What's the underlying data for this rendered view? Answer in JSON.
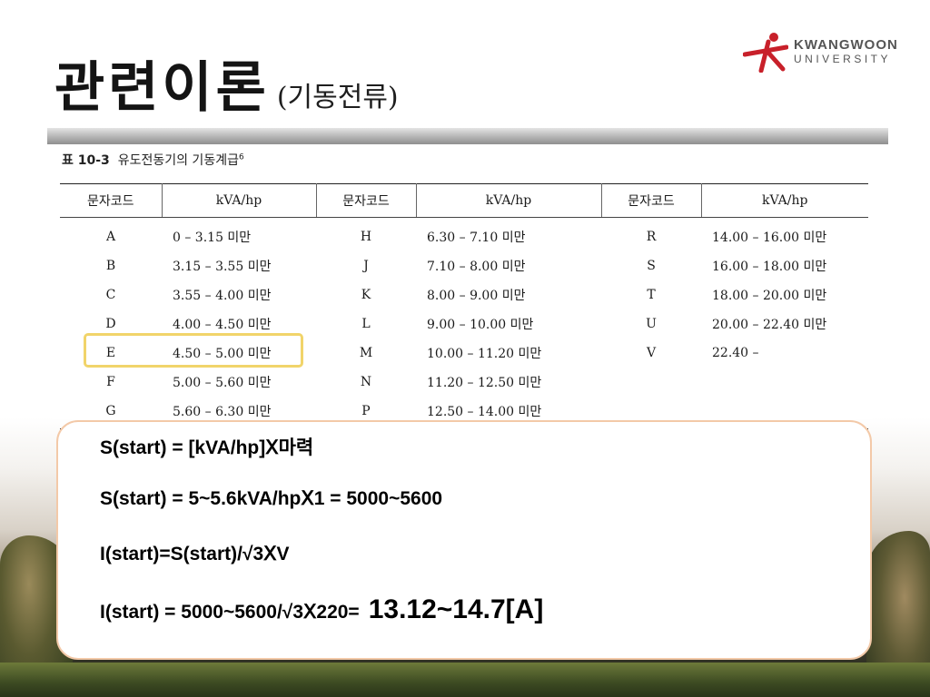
{
  "slide": {
    "title": "관련이론",
    "subtitle": "(기동전류)"
  },
  "logo": {
    "line1": "KWANGWOON",
    "line2": "UNIVERSITY",
    "accent_color": "#c8202a"
  },
  "table": {
    "caption_label": "표 10-3",
    "caption_text": "유도전동기의 기동계급",
    "caption_ref": "6",
    "headers": [
      "문자코드",
      "kVA/hp",
      "문자코드",
      "kVA/hp",
      "문자코드",
      "kVA/hp"
    ],
    "rows": [
      [
        "A",
        "0 – 3.15 미만",
        "H",
        "6.30 – 7.10 미만",
        "R",
        "14.00 – 16.00 미만"
      ],
      [
        "B",
        "3.15 – 3.55 미만",
        "J",
        "7.10 – 8.00 미만",
        "S",
        "16.00 – 18.00 미만"
      ],
      [
        "C",
        "3.55 – 4.00 미만",
        "K",
        "8.00 – 9.00 미만",
        "T",
        "18.00 – 20.00 미만"
      ],
      [
        "D",
        "4.00 – 4.50 미만",
        "L",
        "9.00 – 10.00 미만",
        "U",
        "20.00 – 22.40 미만"
      ],
      [
        "E",
        "4.50 – 5.00 미만",
        "M",
        "10.00 – 11.20 미만",
        "V",
        "22.40 –"
      ],
      [
        "F",
        "5.00 – 5.60 미만",
        "N",
        "11.20 – 12.50 미만",
        "",
        ""
      ],
      [
        "G",
        "5.60 – 6.30 미만",
        "P",
        "12.50 – 14.00 미만",
        "",
        ""
      ]
    ],
    "highlight_color": "#f1d46a"
  },
  "calc": {
    "line1": "S(start) = [kVA/hp]Ⅹ마력",
    "line2": "S(start) = 5~5.6kVA/hpⅩ1 = 5000~5600",
    "line3": "I(start)=S(start)/√3ⅩV",
    "line4_a": "I(start) = 5000~5600/√3Ⅹ220=",
    "line4_b": "13.12~14.7[A]",
    "border_color": "#f3c9a8"
  }
}
